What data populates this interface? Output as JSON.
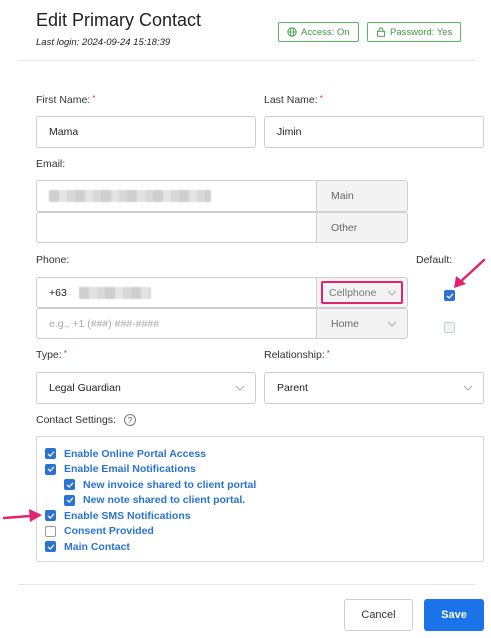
{
  "header": {
    "title": "Edit Primary Contact",
    "last_login": "Last login: 2024-09-24 15:18:39",
    "access_badge": "Access: On",
    "password_badge": "Password: Yes"
  },
  "form": {
    "first_name_label": "First Name:",
    "first_name_value": "Mama",
    "last_name_label": "Last Name:",
    "last_name_value": "Jimin",
    "email_label": "Email:",
    "email_main_tag": "Main",
    "email_other_tag": "Other",
    "phone_label": "Phone:",
    "phone_prefix": "+63",
    "phone_type_1": "Cellphone",
    "phone_placeholder": "e.g., +1 (###) ###-####",
    "phone_type_2": "Home",
    "default_label": "Default:",
    "type_label": "Type:",
    "type_value": "Legal Guardian",
    "relationship_label": "Relationship:",
    "relationship_value": "Parent",
    "required_mark": "*",
    "contact_settings_label": "Contact Settings:",
    "help_glyph": "?"
  },
  "settings": [
    {
      "label": "Enable Online Portal Access",
      "checked": true,
      "indent": false
    },
    {
      "label": "Enable Email Notifications",
      "checked": true,
      "indent": false
    },
    {
      "label": "New invoice shared to client portal",
      "checked": true,
      "indent": true
    },
    {
      "label": "New note shared to client portal.",
      "checked": true,
      "indent": true
    },
    {
      "label": "Enable SMS Notifications",
      "checked": true,
      "indent": false
    },
    {
      "label": "Consent Provided",
      "checked": false,
      "indent": false
    },
    {
      "label": "Main Contact",
      "checked": true,
      "indent": false
    }
  ],
  "footer": {
    "cancel_label": "Cancel",
    "save_label": "Save"
  },
  "colors": {
    "accent": "#2a73d2",
    "highlight": "#e0246e",
    "badge_green": "#5cb85c"
  }
}
